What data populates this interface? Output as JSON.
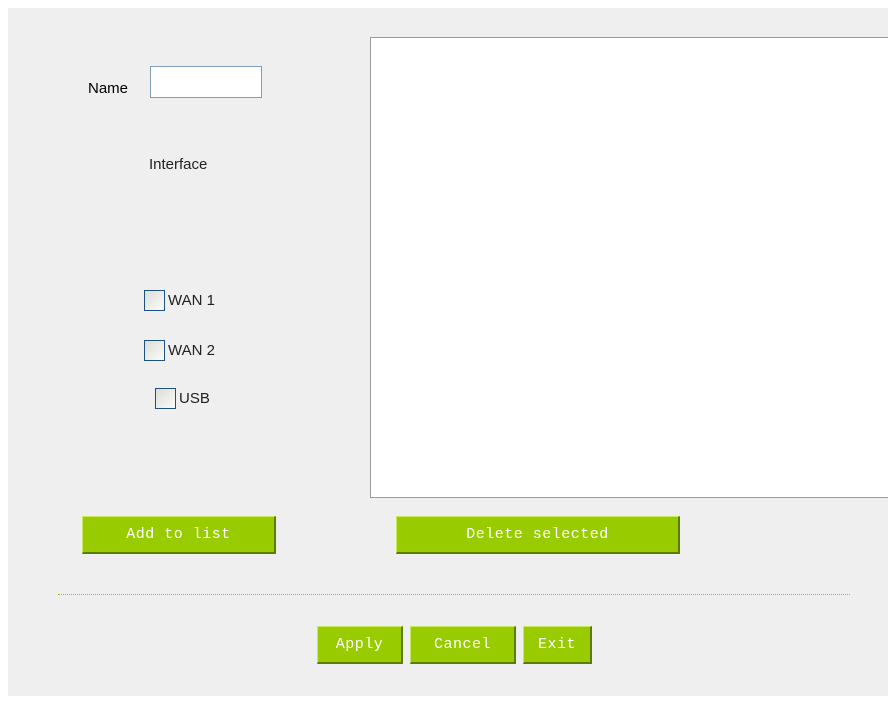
{
  "form": {
    "name_label": "Name",
    "name_value": "",
    "interface_label": "Interface",
    "interfaces": [
      {
        "label": "WAN 1",
        "checked": false
      },
      {
        "label": "WAN 2",
        "checked": false
      },
      {
        "label": "USB",
        "checked": false
      }
    ]
  },
  "list": {
    "items": []
  },
  "buttons": {
    "add_to_list": "Add to list",
    "delete_selected": "Delete selected",
    "apply": "Apply",
    "cancel": "Cancel",
    "exit": "Exit"
  },
  "colors": {
    "button_green": "#99cc00",
    "panel_bg": "#efefef"
  }
}
